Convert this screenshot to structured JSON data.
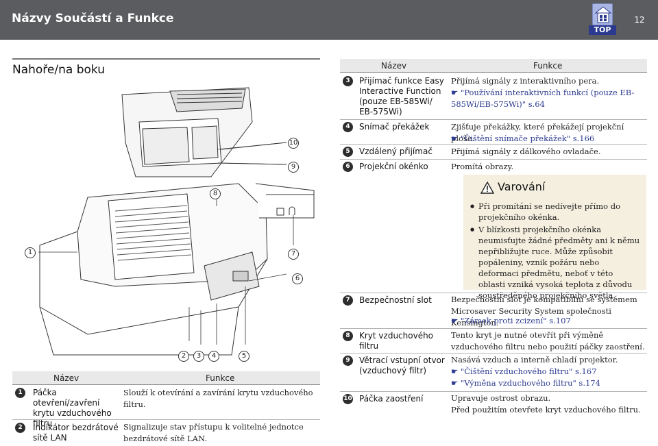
{
  "header": {
    "title": "Názvy Součástí a Funkce",
    "top_label": "TOP",
    "page_number": "12"
  },
  "section": {
    "title": "Nahoře/na boku"
  },
  "callouts": {
    "c1": "1",
    "c2": "2",
    "c3": "3",
    "c4": "4",
    "c5": "5",
    "c6": "6",
    "c7": "7",
    "c8": "8",
    "c9": "9",
    "c10": "10"
  },
  "left_table": {
    "col_name": "Název",
    "col_func": "Funkce",
    "rows": [
      {
        "num": "1",
        "name": "Páčka otevření/zavření krytu vzduchového filtru",
        "func": "Slouží k otevírání a zavírání krytu vzduchového filtru."
      },
      {
        "num": "2",
        "name": "Indikátor bezdrátové sítě LAN",
        "func": "Signalizuje stav přístupu k volitelné jednotce bezdrátové sítě LAN."
      }
    ]
  },
  "right_table": {
    "col_name": "Název",
    "col_func": "Funkce",
    "rows": [
      {
        "num": "3",
        "name": "Přijímač funkce Easy Interactive Function (pouze EB-585Wi/ EB-575Wi)",
        "func": "Přijímá signály z interaktivního pera.",
        "link": "\"Používání interaktivních funkcí (pouze EB-585Wi/EB-575Wi)\" s.64"
      },
      {
        "num": "4",
        "name": "Snímač překážek",
        "func": "Zjišťuje překážky, které překážejí projekční ploše.",
        "link": "\"Čištění snímače překážek\" s.166"
      },
      {
        "num": "5",
        "name": "Vzdálený přijímač",
        "func": "Přijímá signály z dálkového ovladače."
      },
      {
        "num": "6",
        "name": "Projekční okénko",
        "func": "Promítá obrazy."
      }
    ]
  },
  "warning": {
    "title": "Varování",
    "items": [
      "Při promítání se nedívejte přímo do projekčního okénka.",
      "V blízkosti projekčního okénka neumisťujte žádné předměty ani k němu nepřibližujte ruce. Může způsobit popáleniny, vznik požáru nebo deformaci předmětu, neboť v této oblasti vzniká vysoká teplota z důvodu soustředěného projekčního světla."
    ]
  },
  "right_table2": {
    "rows": [
      {
        "num": "7",
        "name": "Bezpečnostní slot",
        "func": "Bezpečnostní slot je kompatibilní se systémem Microsaver Security System společnosti Kensington.",
        "link": "\"Zámek proti zcizení\" s.107"
      },
      {
        "num": "8",
        "name": "Kryt vzduchového filtru",
        "func": "Tento kryt je nutné otevřít při výměně vzduchového filtru nebo použití páčky zaostření."
      },
      {
        "num": "9",
        "name": "Větrací vstupní otvor (vzduchový filtr)",
        "func": "Nasává vzduch a interně chladí projektor.",
        "link1": "\"Čištění vzduchového filtru\" s.167",
        "link2": "\"Výměna vzduchového filtru\" s.174"
      },
      {
        "num": "10",
        "name": "Páčka zaostření",
        "func": "Upravuje ostrost obrazu.",
        "func2": "Před použitím otevřete kryt vzduchového filtru."
      }
    ]
  },
  "colors": {
    "header_bg": "#5a5c5f",
    "table_head_bg": "#e9e9e9",
    "warning_bg": "#f4efdf",
    "link": "#2b3a8f"
  }
}
